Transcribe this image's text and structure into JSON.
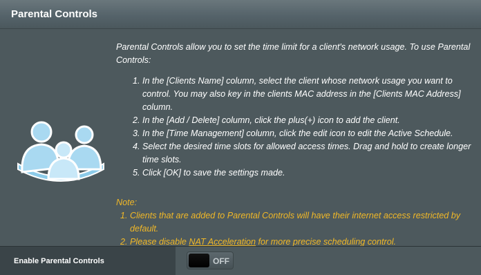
{
  "header": {
    "title": "Parental Controls"
  },
  "description": {
    "intro": "Parental Controls allow you to set the time limit for a client's network usage. To use Parental Controls:",
    "steps": [
      {
        "num": "1.",
        "text": "In the [Clients Name] column, select the client whose network usage you want to control. You may also key in the clients MAC address in the [Clients MAC Address] column."
      },
      {
        "num": "2.",
        "text": "In the [Add / Delete] column, click the plus(+) icon to add the client."
      },
      {
        "num": "3.",
        "text": "In the [Time Management] column, click the edit icon to edit the Active Schedule."
      },
      {
        "num": "4.",
        "text": "Select the desired time slots for allowed access times. Drag and hold to create longer time slots."
      },
      {
        "num": "5.",
        "text": "Click [OK] to save the settings made."
      }
    ]
  },
  "note": {
    "title": "Note:",
    "item1_num": "1.",
    "item1_text": "Clients that are added to Parental Controls will have their internet access restricted by default.",
    "item2_num": "2.",
    "item2_before": "Please disable ",
    "item2_link": "NAT Acceleration",
    "item2_after": " for more precise scheduling control."
  },
  "setting": {
    "label": "Enable Parental Controls",
    "toggle_state": "OFF"
  },
  "colors": {
    "background": "#4d595d",
    "label_cell": "#3a4448",
    "note_text": "#f1b827",
    "icon_blue": "#9fd3ee"
  },
  "icons": {
    "illustration": "family-icon"
  }
}
